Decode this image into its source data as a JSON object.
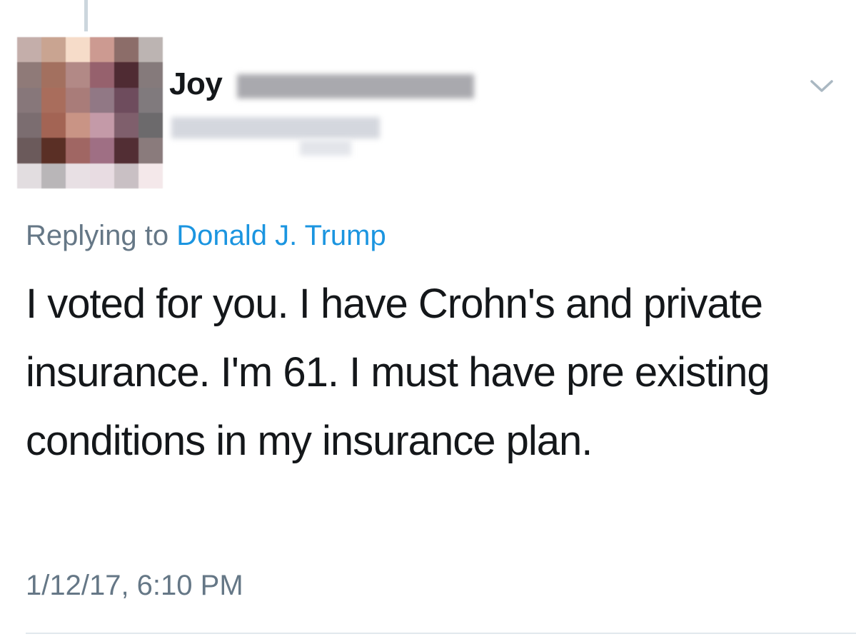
{
  "tweet": {
    "display_name": "Joy",
    "reply_prefix": "Replying to",
    "reply_to": "Donald J. Trump",
    "text": "I voted for you. I have Crohn's and private insurance. I'm 61. I must have pre existing conditions in my insurance plan.",
    "timestamp": "1/12/17, 6:10 PM",
    "menu_icon": "chevron-down-icon"
  },
  "colors": {
    "reply_link": "#1b95e0",
    "secondary_text": "#657786",
    "primary_text": "#14171a",
    "thread_line": "#ccd6dd"
  }
}
